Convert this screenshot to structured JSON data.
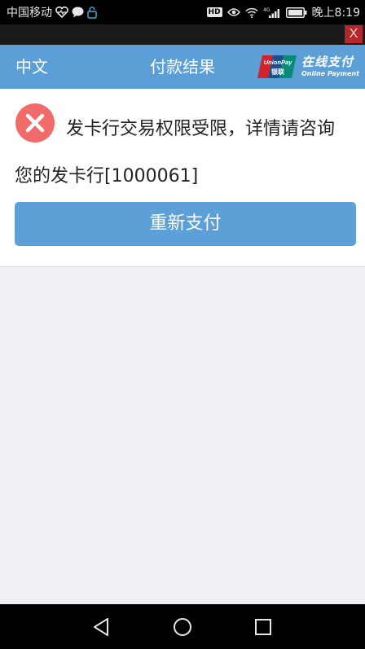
{
  "status_bar": {
    "carrier": "中国移动",
    "network": "4G",
    "time": "晚上8:19",
    "hd": "HD"
  },
  "close_button": {
    "label": "X"
  },
  "header": {
    "language": "中文",
    "title": "付款结果",
    "logo_cn": "在线支付",
    "logo_en": "Online Payment",
    "logo_brand": "UnionPay",
    "logo_brand_cn": "银联",
    "color": "#5b9fd6"
  },
  "result": {
    "status": "error",
    "message": "发卡行交易权限受限，详情请咨询您的发卡行[1000061]",
    "retry_label": "重新支付",
    "error_color": "#f26b6b",
    "button_color": "#5ca0d7"
  },
  "icons": {
    "error": "close-circle-icon",
    "nav_back": "back-triangle-icon",
    "nav_home": "home-circle-icon",
    "nav_recent": "recent-square-icon"
  }
}
